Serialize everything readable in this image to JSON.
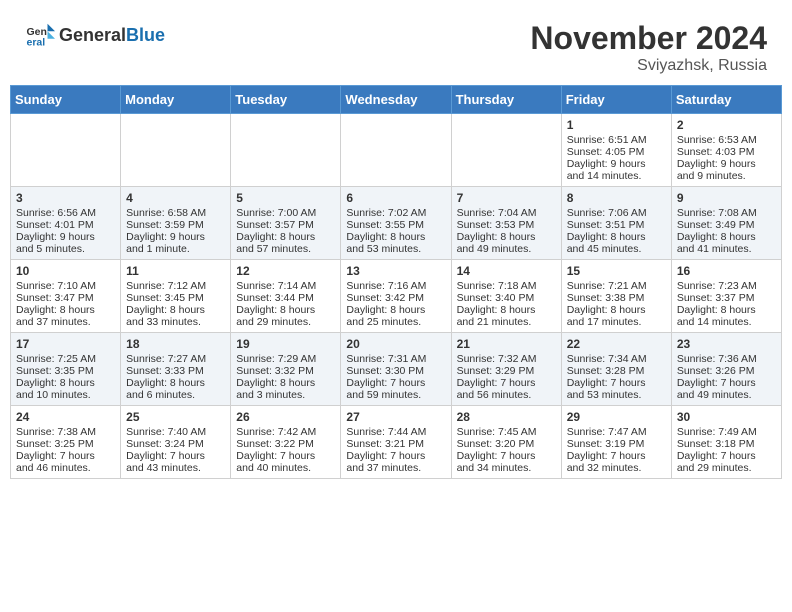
{
  "header": {
    "logo_general": "General",
    "logo_blue": "Blue",
    "month": "November 2024",
    "location": "Sviyazhsk, Russia"
  },
  "weekdays": [
    "Sunday",
    "Monday",
    "Tuesday",
    "Wednesday",
    "Thursday",
    "Friday",
    "Saturday"
  ],
  "weeks": [
    [
      {
        "day": "",
        "info": ""
      },
      {
        "day": "",
        "info": ""
      },
      {
        "day": "",
        "info": ""
      },
      {
        "day": "",
        "info": ""
      },
      {
        "day": "",
        "info": ""
      },
      {
        "day": "1",
        "info": "Sunrise: 6:51 AM\nSunset: 4:05 PM\nDaylight: 9 hours and 14 minutes."
      },
      {
        "day": "2",
        "info": "Sunrise: 6:53 AM\nSunset: 4:03 PM\nDaylight: 9 hours and 9 minutes."
      }
    ],
    [
      {
        "day": "3",
        "info": "Sunrise: 6:56 AM\nSunset: 4:01 PM\nDaylight: 9 hours and 5 minutes."
      },
      {
        "day": "4",
        "info": "Sunrise: 6:58 AM\nSunset: 3:59 PM\nDaylight: 9 hours and 1 minute."
      },
      {
        "day": "5",
        "info": "Sunrise: 7:00 AM\nSunset: 3:57 PM\nDaylight: 8 hours and 57 minutes."
      },
      {
        "day": "6",
        "info": "Sunrise: 7:02 AM\nSunset: 3:55 PM\nDaylight: 8 hours and 53 minutes."
      },
      {
        "day": "7",
        "info": "Sunrise: 7:04 AM\nSunset: 3:53 PM\nDaylight: 8 hours and 49 minutes."
      },
      {
        "day": "8",
        "info": "Sunrise: 7:06 AM\nSunset: 3:51 PM\nDaylight: 8 hours and 45 minutes."
      },
      {
        "day": "9",
        "info": "Sunrise: 7:08 AM\nSunset: 3:49 PM\nDaylight: 8 hours and 41 minutes."
      }
    ],
    [
      {
        "day": "10",
        "info": "Sunrise: 7:10 AM\nSunset: 3:47 PM\nDaylight: 8 hours and 37 minutes."
      },
      {
        "day": "11",
        "info": "Sunrise: 7:12 AM\nSunset: 3:45 PM\nDaylight: 8 hours and 33 minutes."
      },
      {
        "day": "12",
        "info": "Sunrise: 7:14 AM\nSunset: 3:44 PM\nDaylight: 8 hours and 29 minutes."
      },
      {
        "day": "13",
        "info": "Sunrise: 7:16 AM\nSunset: 3:42 PM\nDaylight: 8 hours and 25 minutes."
      },
      {
        "day": "14",
        "info": "Sunrise: 7:18 AM\nSunset: 3:40 PM\nDaylight: 8 hours and 21 minutes."
      },
      {
        "day": "15",
        "info": "Sunrise: 7:21 AM\nSunset: 3:38 PM\nDaylight: 8 hours and 17 minutes."
      },
      {
        "day": "16",
        "info": "Sunrise: 7:23 AM\nSunset: 3:37 PM\nDaylight: 8 hours and 14 minutes."
      }
    ],
    [
      {
        "day": "17",
        "info": "Sunrise: 7:25 AM\nSunset: 3:35 PM\nDaylight: 8 hours and 10 minutes."
      },
      {
        "day": "18",
        "info": "Sunrise: 7:27 AM\nSunset: 3:33 PM\nDaylight: 8 hours and 6 minutes."
      },
      {
        "day": "19",
        "info": "Sunrise: 7:29 AM\nSunset: 3:32 PM\nDaylight: 8 hours and 3 minutes."
      },
      {
        "day": "20",
        "info": "Sunrise: 7:31 AM\nSunset: 3:30 PM\nDaylight: 7 hours and 59 minutes."
      },
      {
        "day": "21",
        "info": "Sunrise: 7:32 AM\nSunset: 3:29 PM\nDaylight: 7 hours and 56 minutes."
      },
      {
        "day": "22",
        "info": "Sunrise: 7:34 AM\nSunset: 3:28 PM\nDaylight: 7 hours and 53 minutes."
      },
      {
        "day": "23",
        "info": "Sunrise: 7:36 AM\nSunset: 3:26 PM\nDaylight: 7 hours and 49 minutes."
      }
    ],
    [
      {
        "day": "24",
        "info": "Sunrise: 7:38 AM\nSunset: 3:25 PM\nDaylight: 7 hours and 46 minutes."
      },
      {
        "day": "25",
        "info": "Sunrise: 7:40 AM\nSunset: 3:24 PM\nDaylight: 7 hours and 43 minutes."
      },
      {
        "day": "26",
        "info": "Sunrise: 7:42 AM\nSunset: 3:22 PM\nDaylight: 7 hours and 40 minutes."
      },
      {
        "day": "27",
        "info": "Sunrise: 7:44 AM\nSunset: 3:21 PM\nDaylight: 7 hours and 37 minutes."
      },
      {
        "day": "28",
        "info": "Sunrise: 7:45 AM\nSunset: 3:20 PM\nDaylight: 7 hours and 34 minutes."
      },
      {
        "day": "29",
        "info": "Sunrise: 7:47 AM\nSunset: 3:19 PM\nDaylight: 7 hours and 32 minutes."
      },
      {
        "day": "30",
        "info": "Sunrise: 7:49 AM\nSunset: 3:18 PM\nDaylight: 7 hours and 29 minutes."
      }
    ]
  ]
}
